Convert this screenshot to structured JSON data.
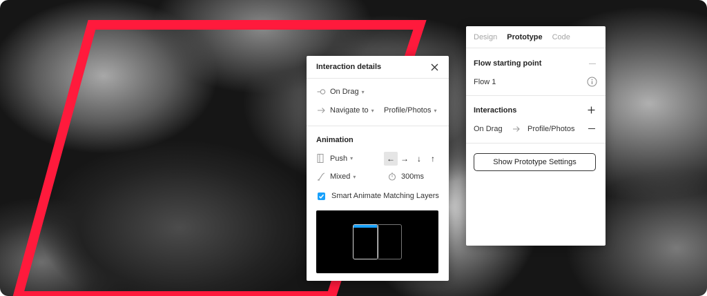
{
  "interaction_details": {
    "title": "Interaction details",
    "trigger": "On Drag",
    "action": "Navigate to",
    "destination": "Profile/Photos",
    "animation": {
      "section_title": "Animation",
      "type": "Push",
      "easing": "Mixed",
      "duration": "300ms",
      "directions": [
        "←",
        "→",
        "↓",
        "↑"
      ],
      "active_direction": "←",
      "smart_animate_label": "Smart Animate Matching Layers",
      "smart_animate_checked": true
    }
  },
  "prototype_panel": {
    "tabs": [
      {
        "label": "Design",
        "active": false
      },
      {
        "label": "Prototype",
        "active": true
      },
      {
        "label": "Code",
        "active": false
      }
    ],
    "flow_section_title": "Flow starting point",
    "flow_name": "Flow 1",
    "interactions_title": "Interactions",
    "interaction_row": {
      "trigger": "On Drag",
      "destination": "Profile/Photos"
    },
    "settings_button": "Show Prototype Settings"
  },
  "colors": {
    "accent_red": "#ff1a3c",
    "checkbox_blue": "#18a0fb"
  },
  "icons": {
    "close": "close-icon",
    "trigger": "drag-trigger-icon",
    "action": "arrow-right-icon",
    "push": "push-transition-icon",
    "easing": "easing-curve-icon",
    "duration": "timer-icon",
    "info": "info-icon",
    "add": "plus-icon",
    "remove": "minus-icon"
  }
}
